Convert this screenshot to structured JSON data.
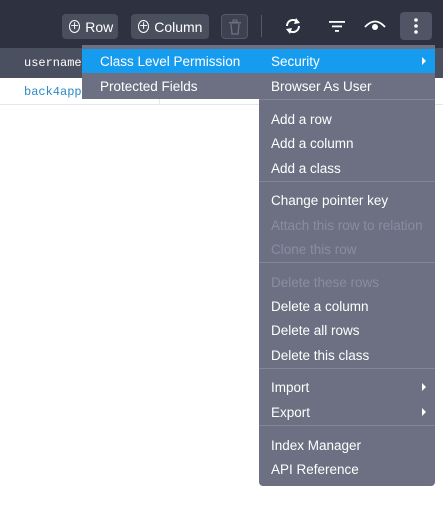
{
  "toolbar": {
    "row_label": "Row",
    "column_label": "Column",
    "trash_icon": "trash-icon",
    "refresh_icon": "refresh-icon",
    "filter_icon": "filter-icon",
    "eye_icon": "eye-icon",
    "more_icon": "more-vertical-icon"
  },
  "table": {
    "headers": [
      "username"
    ],
    "rows": [
      [
        "back4app"
      ]
    ]
  },
  "security_submenu": {
    "items": [
      "Class Level Permission",
      "Protected Fields"
    ]
  },
  "menu": {
    "security": "Security",
    "browser_as_user": "Browser As User",
    "add_row": "Add a row",
    "add_column": "Add a column",
    "add_class": "Add a class",
    "change_pointer_key": "Change pointer key",
    "attach_row_to_relation": "Attach this row to relation",
    "clone_row": "Clone this row",
    "delete_these_rows": "Delete these rows",
    "delete_column": "Delete a column",
    "delete_all_rows": "Delete all rows",
    "delete_class": "Delete this class",
    "import": "Import",
    "export": "Export",
    "index_manager": "Index Manager",
    "api_reference": "API Reference"
  },
  "colors": {
    "toolbar_bg": "#2d3140",
    "menu_bg": "#6c7082",
    "active_item": "#169cee",
    "link_text": "#2a8bc8"
  }
}
